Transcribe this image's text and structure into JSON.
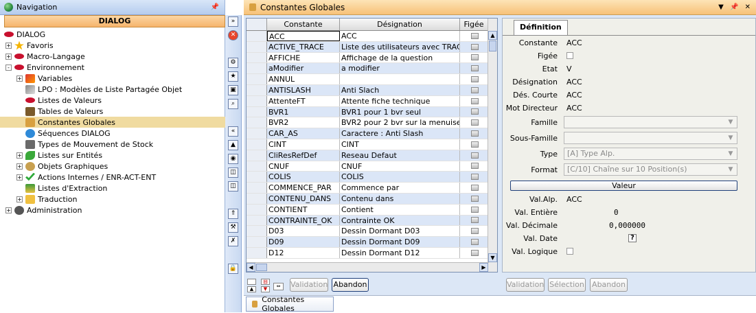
{
  "nav": {
    "title": "Navigation",
    "header": "DIALOG",
    "items": [
      {
        "label": "DIALOG",
        "indent": 0,
        "exp": "",
        "icon": "lips"
      },
      {
        "label": "Favoris",
        "indent": 1,
        "exp": "+",
        "icon": "star"
      },
      {
        "label": "Macro-Langage",
        "indent": 1,
        "exp": "+",
        "icon": "lips"
      },
      {
        "label": "Environnement",
        "indent": 1,
        "exp": "-",
        "icon": "lips"
      },
      {
        "label": "Variables",
        "indent": 2,
        "exp": "+",
        "icon": "variables"
      },
      {
        "label": "LPO : Modèles de Liste Partagée Objet",
        "indent": 2,
        "exp": "",
        "icon": "pen"
      },
      {
        "label": "Listes de Valeurs",
        "indent": 2,
        "exp": "",
        "icon": "lips"
      },
      {
        "label": "Tables de Valeurs",
        "indent": 2,
        "exp": "",
        "icon": "table"
      },
      {
        "label": "Constantes Globales",
        "indent": 2,
        "exp": "",
        "icon": "lock",
        "selected": true
      },
      {
        "label": "Séquences DIALOG",
        "indent": 2,
        "exp": "",
        "icon": "refresh"
      },
      {
        "label": "Types de Mouvement de Stock",
        "indent": 2,
        "exp": "",
        "icon": "forklift"
      },
      {
        "label": "Listes sur Entités",
        "indent": 2,
        "exp": "+",
        "icon": "leaf"
      },
      {
        "label": "Objets Graphiques",
        "indent": 2,
        "exp": "+",
        "icon": "gear"
      },
      {
        "label": "Actions Internes / ENR-ACT-ENT",
        "indent": 2,
        "exp": "+",
        "icon": "check"
      },
      {
        "label": "Listes d'Extraction",
        "indent": 2,
        "exp": "",
        "icon": "export"
      },
      {
        "label": "Traduction",
        "indent": 2,
        "exp": "+",
        "icon": "folder"
      },
      {
        "label": "Administration",
        "indent": 1,
        "exp": "+",
        "icon": "admin"
      }
    ]
  },
  "main": {
    "title": "Constantes Globales"
  },
  "grid": {
    "headers": [
      "Constante",
      "Désignation",
      "Figée"
    ],
    "rows": [
      [
        "ACC",
        "ACC"
      ],
      [
        "ACTIVE_TRACE",
        "Liste des utilisateurs avec TRACE"
      ],
      [
        "AFFICHE",
        "Affichage de la question"
      ],
      [
        "aModifier",
        "a modifier"
      ],
      [
        "ANNUL",
        ""
      ],
      [
        "ANTISLASH",
        "Anti Slach"
      ],
      [
        "AttenteFT",
        "Attente fiche technique"
      ],
      [
        "BVR1",
        "BVR1 pour 1 bvr seul"
      ],
      [
        "BVR2",
        "BVR2 pour 2 bvr sur la menuiserie"
      ],
      [
        "CAR_AS",
        "Caractere : Anti Slash"
      ],
      [
        "CINT",
        "CINT"
      ],
      [
        "CliResRefDef",
        "Reseau Defaut"
      ],
      [
        "CNUF",
        "CNUF"
      ],
      [
        "COLIS",
        "COLIS"
      ],
      [
        "COMMENCE_PAR",
        "Commence par"
      ],
      [
        "CONTENU_DANS",
        "Contenu dans"
      ],
      [
        "CONTIENT",
        "Contient"
      ],
      [
        "CONTRAINTE_OK",
        "Contrainte OK"
      ],
      [
        "D03",
        "Dessin Dormant D03"
      ],
      [
        "D09",
        "Dessin Dormant D09"
      ],
      [
        "D12",
        "Dessin Dormant D12"
      ]
    ]
  },
  "def": {
    "tab": "Définition",
    "labels": {
      "constante": "Constante",
      "figee": "Figée",
      "etat": "Etat",
      "designation": "Désignation",
      "des_courte": "Dés. Courte",
      "mot_directeur": "Mot Directeur",
      "famille": "Famille",
      "sous_famille": "Sous-Famille",
      "type": "Type",
      "format": "Format",
      "val_alp": "Val.Alp.",
      "val_entiere": "Val. Entière",
      "val_decimale": "Val. Décimale",
      "val_date": "Val. Date",
      "val_logique": "Val. Logique"
    },
    "values": {
      "constante": "ACC",
      "etat": "V",
      "designation": "ACC",
      "des_courte": "ACC",
      "mot_directeur": "ACC",
      "type": "[A] Type Alp.",
      "format": "[C/10] Chaîne sur 10 Position(s)",
      "val_alp": "ACC",
      "val_entiere": "0",
      "val_decimale": "0,000000",
      "val_date": "?"
    },
    "valeur_button": "Valeur"
  },
  "buttons": {
    "validation": "Validation",
    "abandon": "Abandon",
    "selection": "Sélection"
  },
  "bottom_tab": "Constantes Globales"
}
